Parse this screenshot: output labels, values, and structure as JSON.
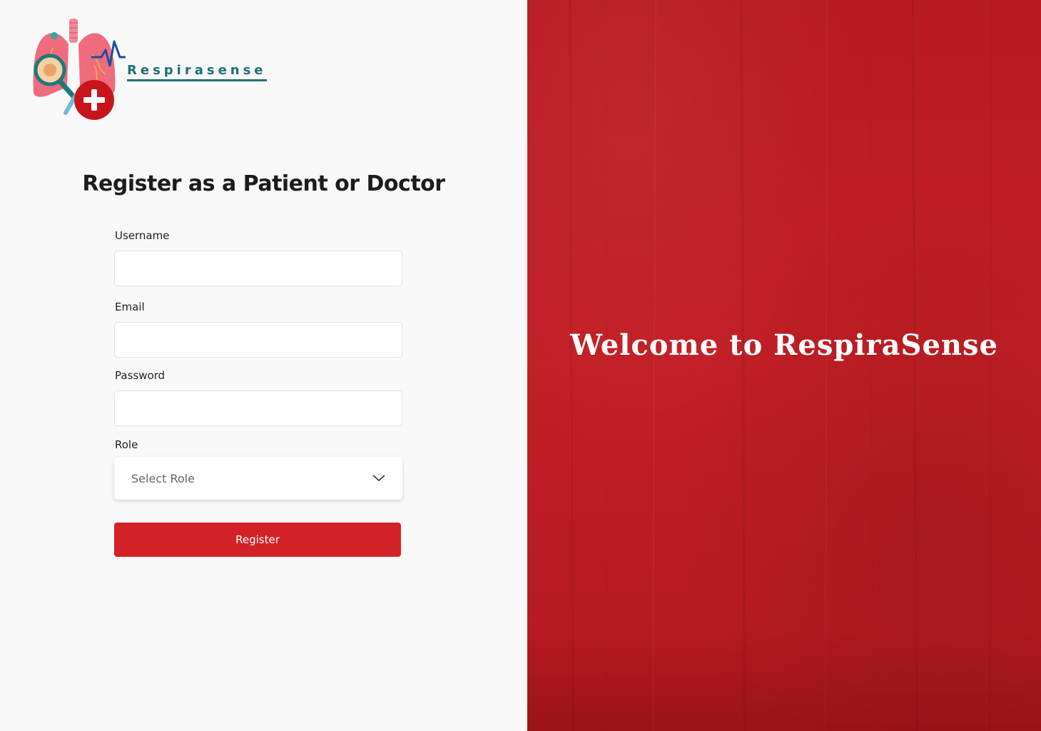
{
  "brand": {
    "name": "Respirasense",
    "logo_icon": "lungs-medical-icon"
  },
  "form": {
    "title": "Register as a Patient or Doctor",
    "username_label": "Username",
    "username_value": "",
    "email_label": "Email",
    "email_value": "",
    "password_label": "Password",
    "password_value": "",
    "role_label": "Role",
    "role_selected": "Select Role",
    "register_label": "Register"
  },
  "welcome": {
    "text": "Welcome to RespiraSense"
  },
  "colors": {
    "accent": "#d32128",
    "panel": "#bd1c23",
    "brand_text": "#1f6f73",
    "background": "#f9f9f9"
  }
}
